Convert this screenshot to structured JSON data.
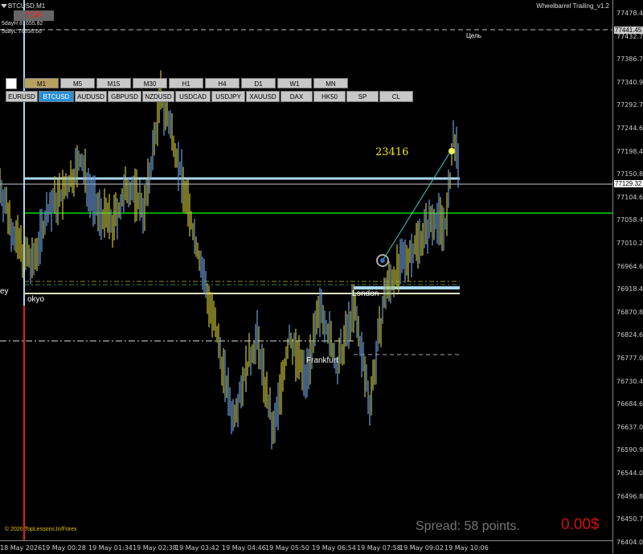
{
  "window": {
    "symbol_title": "BTCUSD,M1",
    "ea_title": "Wheelbarrel Trailing_v1.2",
    "tsr_button": "TSR",
    "stats": [
      "5dayH 81655.82",
      "5dayL 76036.66"
    ]
  },
  "timeframes": [
    {
      "label": "M1",
      "active": true
    },
    {
      "label": "M5",
      "active": false
    },
    {
      "label": "M15",
      "active": false
    },
    {
      "label": "M30",
      "active": false
    },
    {
      "label": "H1",
      "active": false
    },
    {
      "label": "H4",
      "active": false
    },
    {
      "label": "D1",
      "active": false
    },
    {
      "label": "W1",
      "active": false
    },
    {
      "label": "MN",
      "active": false
    }
  ],
  "symbols": [
    {
      "label": "EURUSD",
      "active": false
    },
    {
      "label": "BTCUSD",
      "active": true
    },
    {
      "label": "AUDUSD",
      "active": false
    },
    {
      "label": "GBPUSD",
      "active": false
    },
    {
      "label": "NZDUSD",
      "active": false
    },
    {
      "label": "USDCAD",
      "active": false
    },
    {
      "label": "USDJPY",
      "active": false
    },
    {
      "label": "XAUUSD",
      "active": false
    },
    {
      "label": "DAX",
      "active": false
    },
    {
      "label": "HK50",
      "active": false
    },
    {
      "label": "SP",
      "active": false
    },
    {
      "label": "CL",
      "active": false
    }
  ],
  "annotations": {
    "target_label": "Цель",
    "distance_points": "23416",
    "session_sydney": "ey",
    "session_tokyo": "okyo",
    "session_london": "London",
    "session_frankfurt": "Frankfurt"
  },
  "footer": {
    "copyright": "© 2020 TopLessons.In/Forex",
    "spread": "Spread: 58 points.",
    "profit": "0.00$"
  },
  "price_axis": {
    "ticks": [
      "77478.40",
      "77432.70",
      "77386.70",
      "77340.90",
      "77292.70",
      "77244.60",
      "77198.40",
      "77150.80",
      "77104.60",
      "77058.40",
      "77010.20",
      "76964.60",
      "76918.40",
      "76870.80",
      "76824.60",
      "76777.00",
      "76730.40",
      "76684.60",
      "76637.00",
      "76590.90",
      "76544.00",
      "76496.80",
      "76450.70",
      "76404.00"
    ],
    "target_price": "77441.45",
    "current_price": "77129.32"
  },
  "time_axis": {
    "ticks": [
      "18 May 2026",
      "19 May 00:28",
      "19 May 01:34",
      "19 May 02:38",
      "19 May 03:42",
      "19 May 04:46",
      "19 May 05:50",
      "19 May 06:54",
      "19 May 07:58",
      "19 May 09:02",
      "19 May 10:06"
    ]
  },
  "colors": {
    "background": "#000000",
    "candles": "#6f9ed8",
    "wick_yellow": "#c8c23a",
    "level_cyan": "#a8d8f0",
    "level_green": "#00a000",
    "trend_line": "#40c8c8",
    "vertical_line_red": "#e02020",
    "vertical_line_light": "#a8d8f0",
    "profit_red": "#d01010"
  }
}
